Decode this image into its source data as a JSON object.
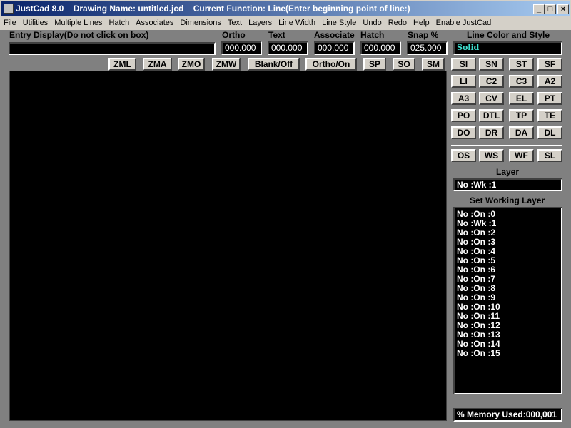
{
  "title": "JustCad 8.0    Drawing Name: untitled.jcd    Current Function: Line(Enter beginning point of line:)",
  "menu": [
    "File",
    "Utilities",
    "Multiple Lines",
    "Hatch",
    "Associates",
    "Dimensions",
    "Text",
    "Layers",
    "Line Width",
    "Line Style",
    "Undo",
    "Redo",
    "Help",
    "Enable JustCad"
  ],
  "entry_label": "Entry Display(Do not click on box)",
  "fields": {
    "ortho_label": "Ortho",
    "ortho": "000.000",
    "text_label": "Text",
    "text": "000.000",
    "assoc_label": "Associate",
    "assoc": "000.000",
    "hatch_label": "Hatch",
    "hatch": "000.000",
    "snap_label": "Snap %",
    "snap": "025.000",
    "style_label": "Line Color and Style",
    "style": "Solid"
  },
  "toolbar": [
    "ZML",
    "ZMA",
    "ZMO",
    "ZMW",
    "Blank/Off",
    "Ortho/On",
    "SP",
    "SO",
    "SM"
  ],
  "grid": [
    "SI",
    "SN",
    "ST",
    "SF",
    "LI",
    "C2",
    "C3",
    "A2",
    "A3",
    "CV",
    "EL",
    "PT",
    "PO",
    "DTL",
    "TP",
    "TE",
    "DO",
    "DR",
    "DA",
    "DL"
  ],
  "grid2": [
    "OS",
    "WS",
    "WF",
    "SL"
  ],
  "layer_label": "Layer",
  "layer": "No :Wk :1",
  "working_label": "Set Working Layer",
  "layers": [
    "No :On :0",
    "No :Wk :1",
    "No :On :2",
    "No :On :3",
    "No :On :4",
    "No :On :5",
    "No :On :6",
    "No :On :7",
    "No :On :8",
    "No :On :9",
    "No :On :10",
    "No :On :11",
    "No :On :12",
    "No :On :13",
    "No :On :14",
    "No :On :15"
  ],
  "memory": "% Memory Used:000,001",
  "colors": {
    "style_text": "#40e0d0"
  }
}
